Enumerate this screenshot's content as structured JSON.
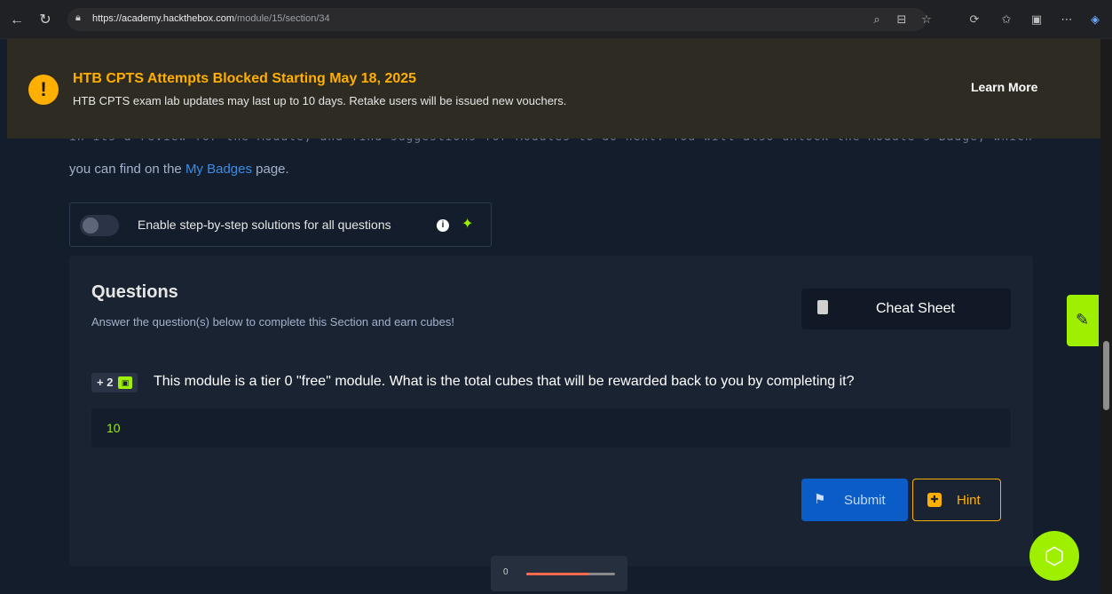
{
  "browser": {
    "url_host": "https://academy.hackthebox.com",
    "url_path": "/module/15/section/34",
    "icons": [
      "back-icon",
      "reload-icon",
      "lock-icon",
      "zoom-icon",
      "reader-icon",
      "favorite-icon",
      "extension-icon",
      "collections-icon",
      "split-icon",
      "more-icon",
      "copilot-icon"
    ]
  },
  "banner": {
    "icon": "!",
    "title": "HTB CPTS Attempts Blocked Starting May 18, 2025",
    "text": "HTB CPTS exam lab updates may last up to 10 days. Retake users will be issued new vouchers.",
    "learn_more": "Learn More"
  },
  "intro": {
    "cut_line": "in its a review for the Module, and find suggestions for Modules to do next. You will also unlock the Module's Badge, which",
    "text_before": "you can find on the ",
    "link": "My Badges",
    "text_after": " page."
  },
  "toggle": {
    "label": "Enable step-by-step solutions for all questions",
    "enabled": false
  },
  "questions": {
    "title": "Questions",
    "subtitle": "Answer the question(s) below to complete this Section and earn cubes!",
    "cheat_sheet": "Cheat Sheet",
    "items": [
      {
        "reward": "+ 2",
        "text": "This module is a tier 0 \"free\" module. What is the total cubes that will be rewarded back to you by completing it?",
        "answer": "10"
      }
    ],
    "submit": "Submit",
    "hint": "Hint"
  },
  "progress": {
    "number": "0",
    "fraction": 0.7
  },
  "colors": {
    "accent": "#9fef00",
    "warning": "#ffaf00",
    "primary": "#0a5cc7",
    "background": "#141d2b"
  }
}
